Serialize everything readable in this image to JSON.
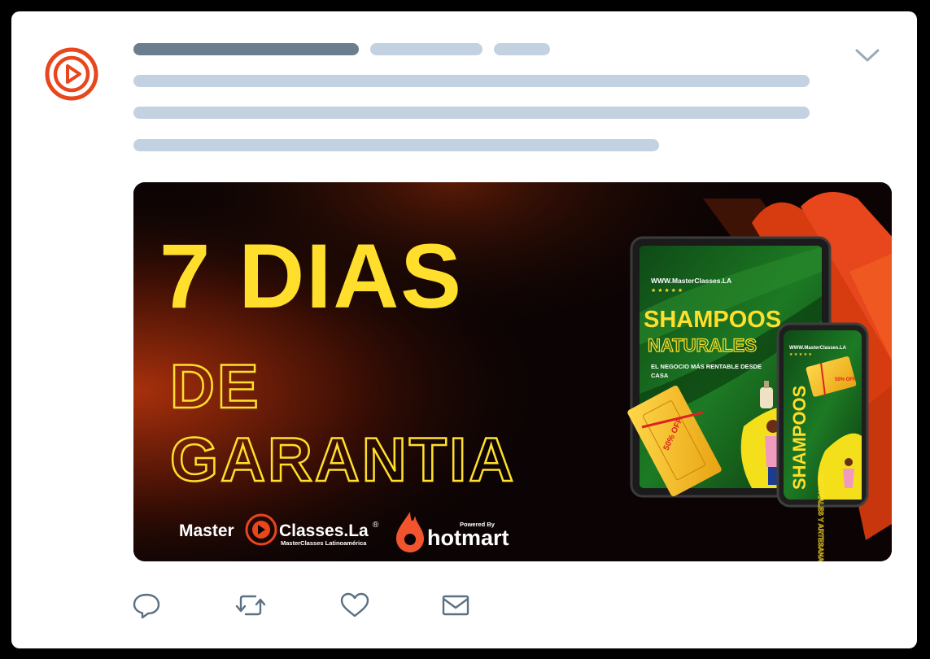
{
  "post": {
    "skeleton_lines": 6
  },
  "banner": {
    "headline_main": "7 DIAS",
    "headline_sub1": "DE",
    "headline_sub2": "GARANTIA",
    "brand_master": "Master",
    "brand_classes": "Classes.La",
    "brand_registered": "®",
    "brand_tagline": "MasterClasses Latinoamérica",
    "powered_by": "Powered By",
    "hotmart": "hotmart",
    "tablet": {
      "url": "WWW.MasterClasses.LA",
      "title1": "SHAMPOOS",
      "title2": "NATURALES",
      "subtitle": "EL NEGOCIO MÁS RENTABLE DESDE",
      "subtitle2": "CASA",
      "discount": "50% OFF"
    },
    "phone": {
      "url": "WWW.MasterClasses.LA",
      "vertical_title": "SHAMPOOS",
      "vertical_sub": "NATURALES Y ARTESANALES",
      "discount": "50% OFF"
    }
  },
  "colors": {
    "accent_orange": "#e8461c",
    "headline_yellow": "#ffdf2b",
    "skeleton_light": "#c3d2e0",
    "skeleton_dark": "#6b7d8f",
    "icon_gray": "#5b7083"
  },
  "icons": [
    "masterclasses-logo-icon",
    "chevron-down-icon",
    "reply-icon",
    "retweet-icon",
    "like-icon",
    "mail-icon"
  ]
}
